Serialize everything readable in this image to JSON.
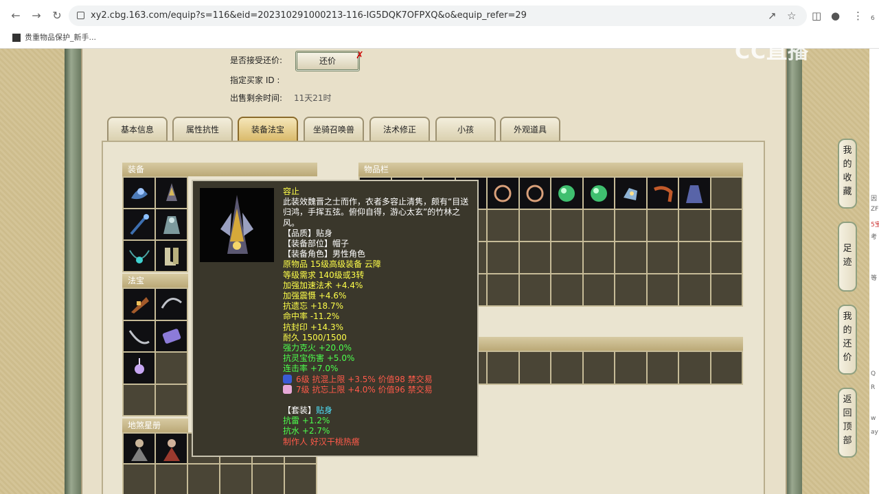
{
  "browser": {
    "url": "xy2.cbg.163.com/equip?s=116&eid=202310291000213-116-IG5DQK7OFPXQ&o&equip_refer=29",
    "bookmark": "贵重物品保护_新手..."
  },
  "sale_info": {
    "accept_counter_label": "是否接受还价:",
    "counter_button": "还价",
    "buyer_id_label": "指定买家 ID :",
    "time_left_label": "出售剩余时间:",
    "time_left_value": "11天21时"
  },
  "tabs": [
    {
      "label": "基本信息",
      "active": false
    },
    {
      "label": "属性抗性",
      "active": false
    },
    {
      "label": "装备法宝",
      "active": true
    },
    {
      "label": "坐骑召唤兽",
      "active": false
    },
    {
      "label": "法术修正",
      "active": false
    },
    {
      "label": "小孩",
      "active": false
    },
    {
      "label": "外观道具",
      "active": false
    }
  ],
  "sections": {
    "equipment": "装备",
    "treasure": "法宝",
    "stars": "地煞星册",
    "inventory": "物品栏"
  },
  "tooltip": {
    "name": "容止",
    "desc": "此装效魏晋之士而作，衣者多容止清隽，颇有“目送归鸿，手挥五弦。俯仰自得，游心太玄”的竹林之风。",
    "lines_white": [
      "【品质】贴身",
      "【装备部位】帽子",
      "【装备角色】男性角色"
    ],
    "lines_yellow": [
      "原物品 15级高级装备 云障",
      "等级需求 140级或3转",
      "加强加速法术 +4.4%",
      "加强震慑 +4.6%",
      "抗遗忘 +18.7%",
      "命中率 -11.2%",
      "抗封印 +14.3%",
      "耐久 1500/1500"
    ],
    "lines_green": [
      "强力克火 +20.0%",
      "抗灵宝伤害 +5.0%",
      "连击率 +7.0%"
    ],
    "gems": [
      {
        "text": "6级 抗混上限 +3.5% 价值98 禁交易",
        "color": "#3b5bd6"
      },
      {
        "text": "7级 抗忘上限 +4.0% 价值96 禁交易",
        "color": "#e7a9d8"
      }
    ],
    "set_label": "【套装】",
    "set_value": "贴身",
    "set_lines": [
      "抗雷 +1.2%",
      "抗水 +2.7%"
    ],
    "maker": "制作人 好汉干桃热瘩"
  },
  "sidenav": [
    {
      "label": "我的收藏"
    },
    {
      "label": "足迹"
    },
    {
      "label": "我的还价"
    },
    {
      "label": "返回顶部"
    }
  ],
  "watermark": "CC直播",
  "right_strip": [
    "6",
    "因",
    "ZF",
    "5宝",
    "考",
    "等",
    "Q",
    "R",
    "w",
    "ay"
  ]
}
